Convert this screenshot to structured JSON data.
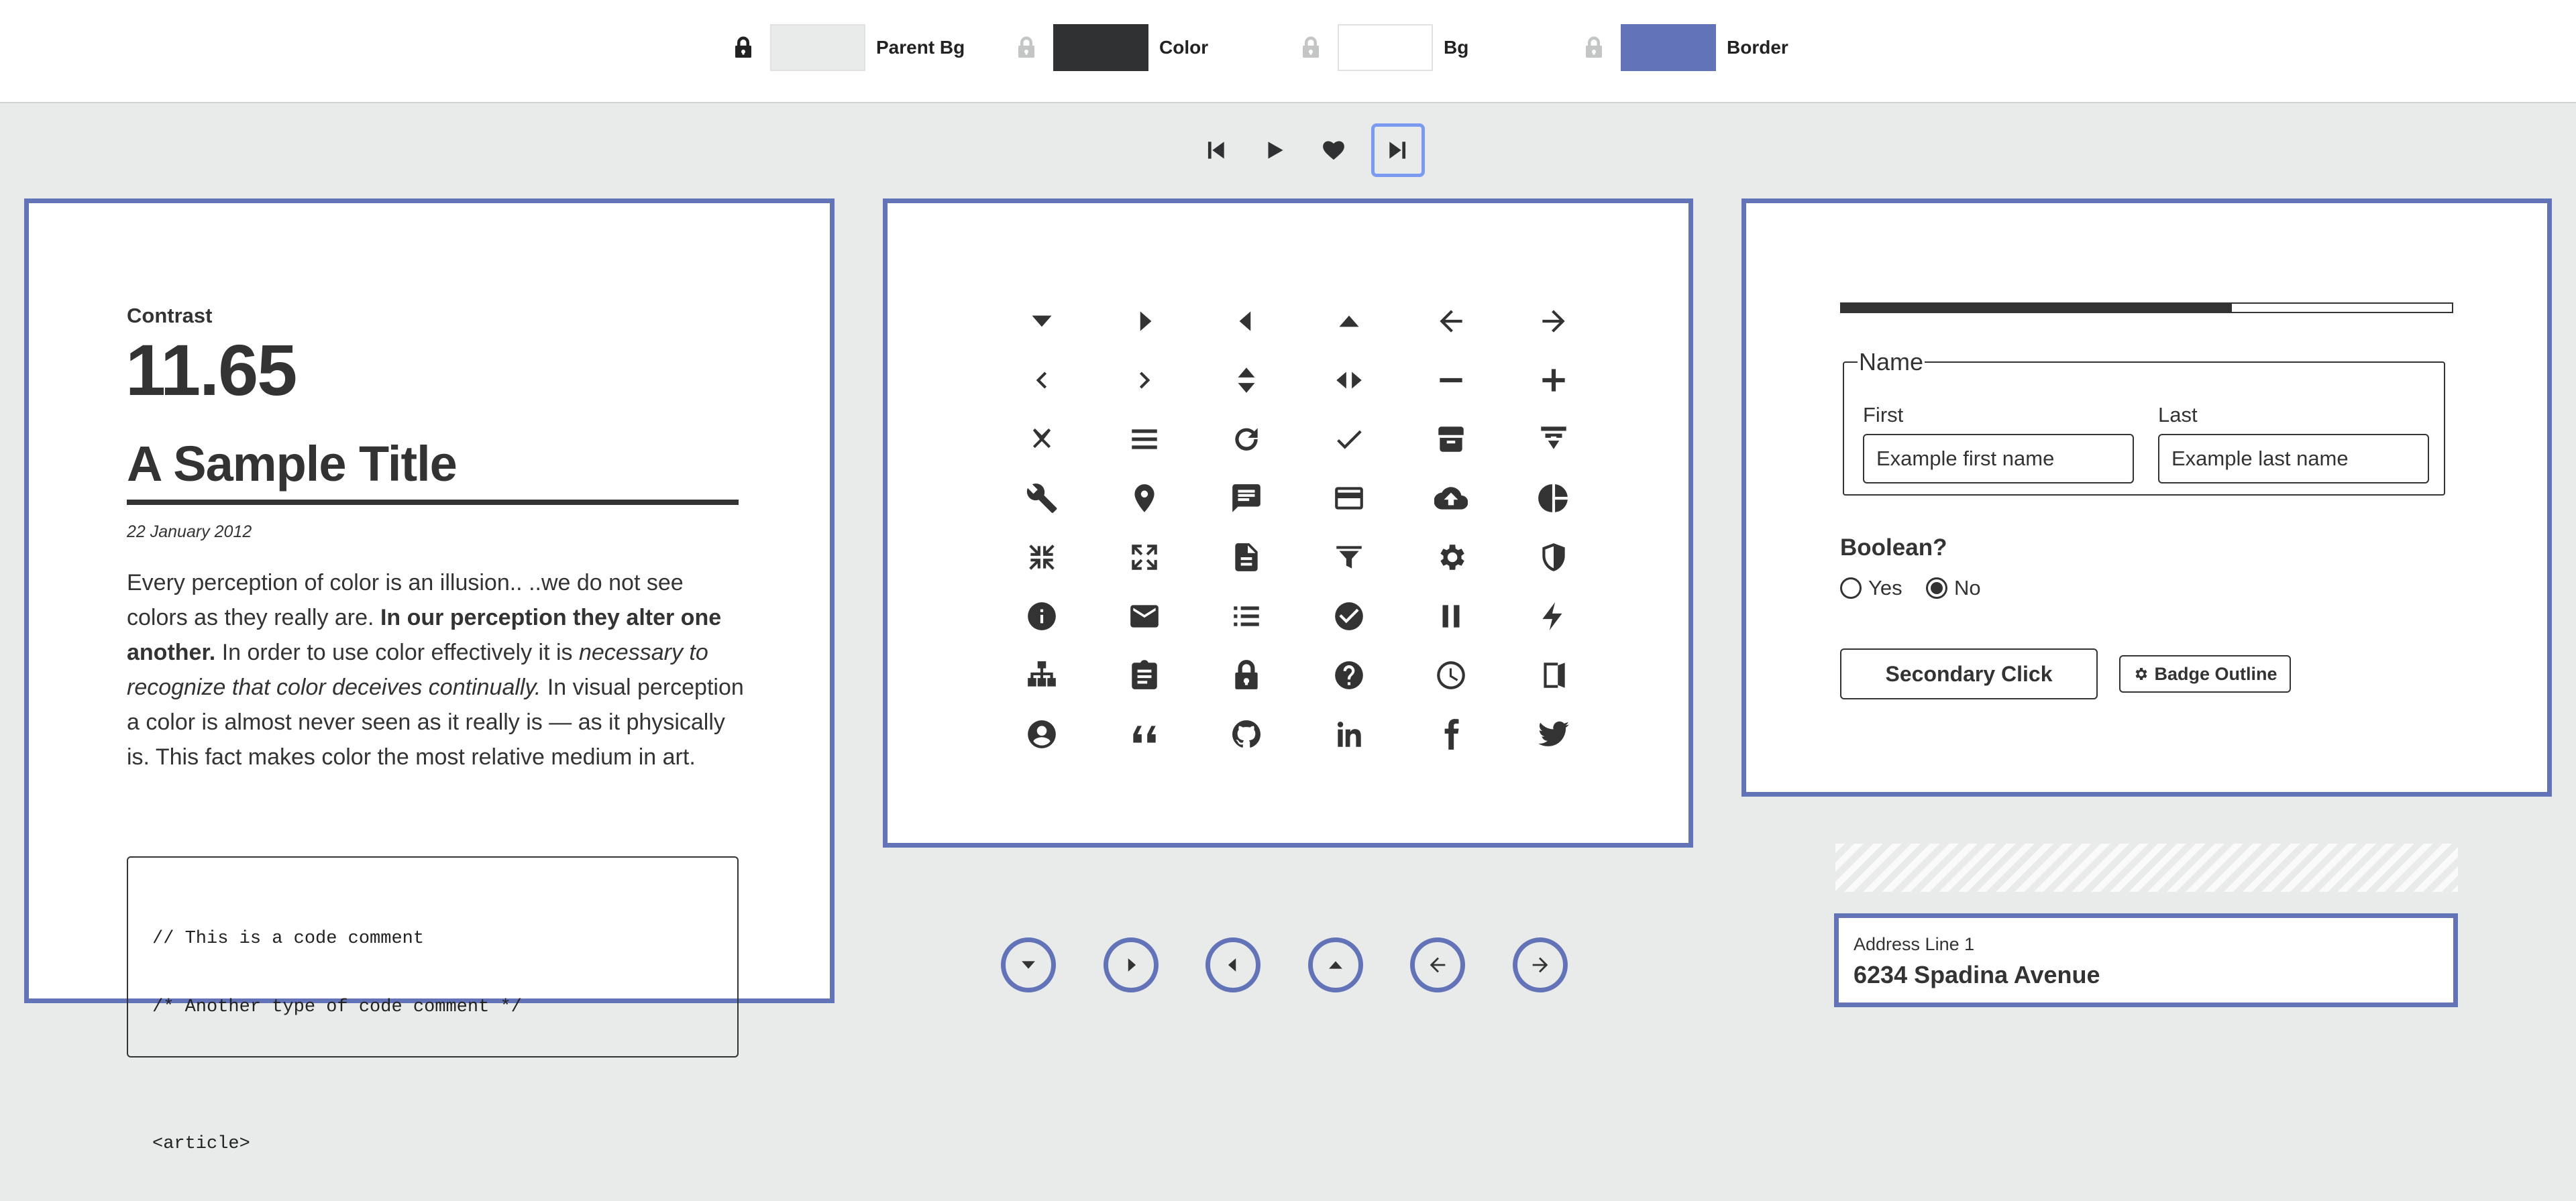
{
  "toolbar": {
    "swatches": [
      {
        "label": "Parent Bg",
        "color": "#e9ebeb",
        "locked": true
      },
      {
        "label": "Color",
        "color": "#2f3133",
        "locked": false
      },
      {
        "label": "Bg",
        "color": "#ffffff",
        "locked": false
      },
      {
        "label": "Border",
        "color": "#6373b8",
        "locked": false
      }
    ],
    "controls": [
      "skip-back-icon",
      "play-icon",
      "heart-icon",
      "skip-forward-icon"
    ],
    "active_control": "skip-forward-icon"
  },
  "text_panel": {
    "contrast_label": "Contrast",
    "contrast_value": "11.65",
    "title": "A Sample Title",
    "date": "22 January 2012",
    "p1": "Every perception of color is an illusion.. ..we do not see colors as they really are. ",
    "p_bold": "In our perception they alter one another.",
    "p2": " In order to use color effectively it is ",
    "p_italic": "necessary to recognize that color deceives continually.",
    "p3": " In visual perception a color is almost never seen as it really is — as it physically is. This fact makes color the most relative medium in art.",
    "code": [
      "// This is a code comment",
      "/* Another type of code comment */",
      "",
      "<article>"
    ]
  },
  "icon_panel": {
    "icons": [
      "caret-down-icon",
      "caret-right-icon",
      "caret-left-icon",
      "caret-up-icon",
      "arrow-left-icon",
      "arrow-right-icon",
      "chevron-left-icon",
      "chevron-right-icon",
      "sort-vertical-icon",
      "sort-horizontal-icon",
      "minus-icon",
      "plus-icon",
      "close-icon",
      "menu-icon",
      "refresh-icon",
      "check-icon",
      "archive-icon",
      "download-icon",
      "wrench-icon",
      "map-pin-icon",
      "comment-icon",
      "credit-card-icon",
      "cloud-upload-icon",
      "pie-chart-icon",
      "compress-icon",
      "expand-icon",
      "document-icon",
      "filter-icon",
      "gear-icon",
      "shield-icon",
      "info-icon",
      "mail-icon",
      "list-icon",
      "check-circle-icon",
      "pause-icon",
      "bolt-icon",
      "sitemap-icon",
      "clipboard-icon",
      "lock-icon",
      "question-icon",
      "clock-icon",
      "exit-icon",
      "user-circle-icon",
      "quote-icon",
      "github-icon",
      "linkedin-icon",
      "facebook-icon",
      "twitter-icon"
    ],
    "circle_icons": [
      "caret-down-icon",
      "caret-right-icon",
      "caret-left-icon",
      "caret-up-icon",
      "arrow-left-icon",
      "arrow-right-icon"
    ]
  },
  "form_panel": {
    "progress": 0.64,
    "fieldset_legend": "Name",
    "first_label": "First",
    "first_placeholder": "Example first name",
    "last_label": "Last",
    "last_placeholder": "Example last name",
    "boolean_label": "Boolean?",
    "yes_label": "Yes",
    "no_label": "No",
    "selected": "No",
    "secondary_button": "Secondary Click",
    "badge_label": "Badge Outline"
  },
  "address_panel": {
    "label": "Address Line 1",
    "value": "6234 Spadina Avenue"
  }
}
